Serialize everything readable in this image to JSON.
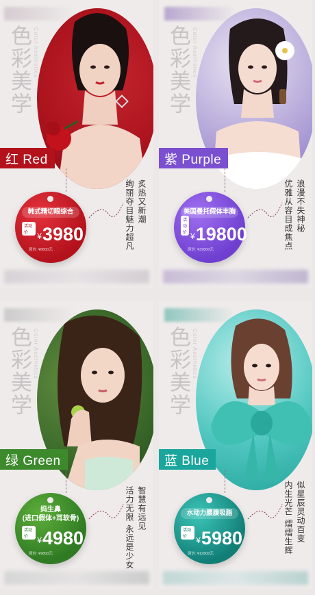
{
  "posters": [
    {
      "header": "色彩美学",
      "subheader": "Color Aesthetics",
      "color_label": "红 Red",
      "tag": {
        "name": "韩式精切眼综合",
        "badge": "活动价",
        "currency": "¥",
        "price": "3980",
        "original": "原价: ¥8800元"
      },
      "slogan": [
        "炙热又新潮",
        "绚丽夺目魅力超凡"
      ],
      "accent": "#b3121c"
    },
    {
      "header": "色彩美学",
      "subheader": "Color Aesthetics",
      "color_label": "紫 Purple",
      "tag": {
        "name": "美国曼托假体丰胸",
        "badge": "活动价",
        "currency": "¥",
        "price": "19800",
        "original": "原价: ¥39800元"
      },
      "slogan": [
        "浪漫不失神秘",
        "优雅从容目成焦点"
      ],
      "accent": "#7a4fd0"
    },
    {
      "header": "色彩美学",
      "subheader": "Color Aesthetics",
      "color_label": "绿 Green",
      "tag": {
        "name_line1": "妈生鼻",
        "name_line2": "(进口假体+耳软骨)",
        "badge": "活动价",
        "currency": "¥",
        "price": "4980",
        "original": "原价: ¥9800元"
      },
      "slogan": [
        "智慧有远见",
        "活力无限 永远是少女"
      ],
      "accent": "#3d8a2c"
    },
    {
      "header": "色彩美学",
      "subheader": "Color Aesthetics",
      "color_label": "蓝 Blue",
      "tag": {
        "name": "水动力腰腹吸脂",
        "badge": "活动价",
        "currency": "¥",
        "price": "5980",
        "original": "原价: ¥12800元"
      },
      "slogan": [
        "似星辰灵动百变",
        "内生光芒 熠熠生辉"
      ],
      "accent": "#1aa69c"
    }
  ]
}
